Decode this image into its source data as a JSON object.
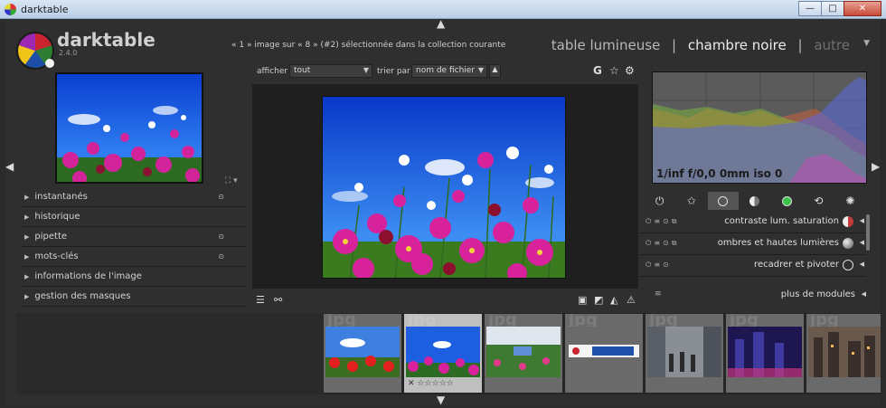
{
  "window": {
    "title": "darktable",
    "min": "—",
    "max": "□",
    "close": "✕"
  },
  "header": {
    "brand": "darktable",
    "version": "2.4.0",
    "status": "« 1 » image sur « 8 » (#2) sélectionnée dans la collection courante",
    "views": {
      "lighttable": "table lumineuse",
      "sep": "|",
      "darkroom": "chambre noire",
      "other": "autre"
    }
  },
  "left_panel": {
    "modules": [
      {
        "label": "instantanés",
        "pinned": true
      },
      {
        "label": "historique",
        "pinned": false
      },
      {
        "label": "pipette",
        "pinned": true
      },
      {
        "label": "mots-clés",
        "pinned": true
      },
      {
        "label": "informations de l'image",
        "pinned": false
      },
      {
        "label": "gestion des masques",
        "pinned": false
      }
    ]
  },
  "toolbar": {
    "show_label": "afficher",
    "show_value": "tout",
    "sort_label": "trier par",
    "sort_value": "nom de fichier",
    "grouping_glyph": "G",
    "star_glyph": "☆",
    "gear_glyph": "⚙"
  },
  "histogram": {
    "exif": "1/inf f/0,0 0mm iso 0"
  },
  "right_panel": {
    "modules": [
      {
        "name": "contraste lum. saturation",
        "color": "#c23a3a"
      },
      {
        "name": "ombres et hautes lumières",
        "color": "#aaaaaa"
      },
      {
        "name": "recadrer et pivoter",
        "color": "#444444"
      }
    ],
    "more_modules": "plus de modules"
  },
  "filmstrip": {
    "type_label": "jpg",
    "thumbs": [
      "poppies",
      "cosmos",
      "garden",
      "darktable-ui",
      "street",
      "city-night",
      "city-dusk"
    ],
    "selected_index": 1,
    "stars": "✕ ☆☆☆☆☆"
  },
  "colors": {
    "accent": "#3a7bd5",
    "panel": "#2f2f2f",
    "canvas": "#1f1f1f"
  }
}
